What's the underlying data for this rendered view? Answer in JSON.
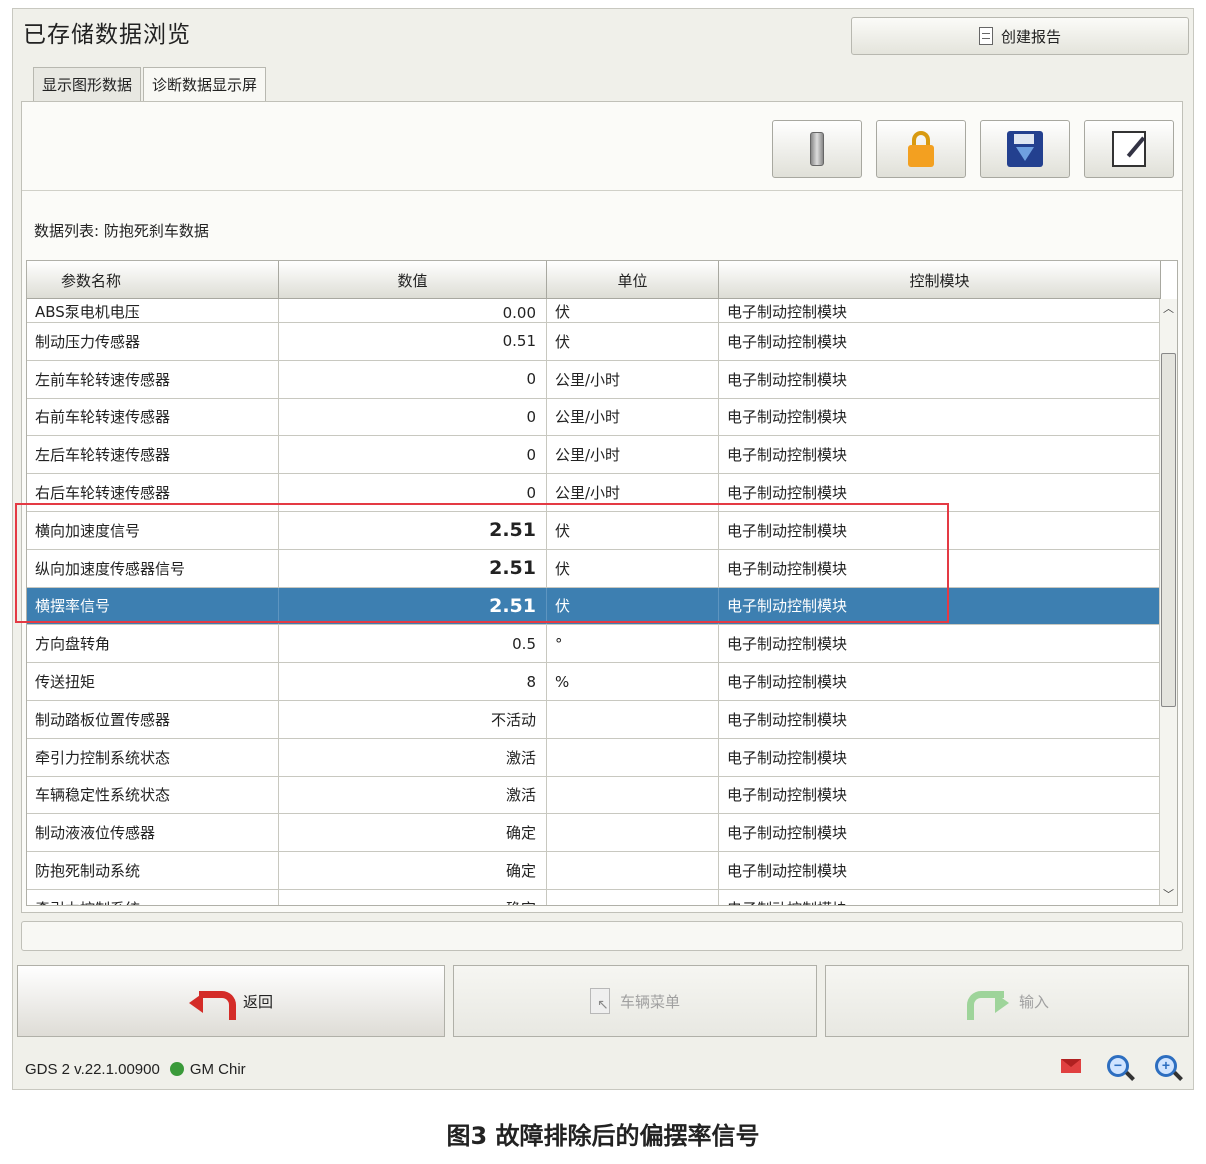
{
  "window": {
    "title": "已存储数据浏览",
    "create_report_label": "创建报告"
  },
  "tabs": [
    {
      "label": "显示图形数据",
      "active": false
    },
    {
      "label": "诊断数据显示屏",
      "active": true
    }
  ],
  "toolbar": {
    "icons": [
      "tool-icon",
      "lock-icon",
      "save-icon",
      "edit-icon"
    ]
  },
  "data_list": {
    "label": "数据列表:  防抱死刹车数据",
    "columns": [
      "参数名称",
      "数值",
      "单位",
      "控制模块"
    ],
    "rows": [
      {
        "name": "ABS泵电机电压",
        "value": "0.00",
        "unit": "伏",
        "module": "电子制动控制模块"
      },
      {
        "name": "制动压力传感器",
        "value": "0.51",
        "unit": "伏",
        "module": "电子制动控制模块"
      },
      {
        "name": "左前车轮转速传感器",
        "value": "0",
        "unit": "公里/小时",
        "module": "电子制动控制模块"
      },
      {
        "name": "右前车轮转速传感器",
        "value": "0",
        "unit": "公里/小时",
        "module": "电子制动控制模块"
      },
      {
        "name": "左后车轮转速传感器",
        "value": "0",
        "unit": "公里/小时",
        "module": "电子制动控制模块"
      },
      {
        "name": "右后车轮转速传感器",
        "value": "0",
        "unit": "公里/小时",
        "module": "电子制动控制模块"
      },
      {
        "name": "横向加速度信号",
        "value": "2.51",
        "unit": "伏",
        "module": "电子制动控制模块"
      },
      {
        "name": "纵向加速度传感器信号",
        "value": "2.51",
        "unit": "伏",
        "module": "电子制动控制模块"
      },
      {
        "name": "横摆率信号",
        "value": "2.51",
        "unit": "伏",
        "module": "电子制动控制模块"
      },
      {
        "name": "方向盘转角",
        "value": "0.5",
        "unit": "°",
        "module": "电子制动控制模块"
      },
      {
        "name": "传送扭矩",
        "value": "8",
        "unit": "%",
        "module": "电子制动控制模块"
      },
      {
        "name": "制动踏板位置传感器",
        "value": "不活动",
        "unit": "",
        "module": "电子制动控制模块"
      },
      {
        "name": "牵引力控制系统状态",
        "value": "激活",
        "unit": "",
        "module": "电子制动控制模块"
      },
      {
        "name": "车辆稳定性系统状态",
        "value": "激活",
        "unit": "",
        "module": "电子制动控制模块"
      },
      {
        "name": "制动液液位传感器",
        "value": "确定",
        "unit": "",
        "module": "电子制动控制模块"
      },
      {
        "name": "防抱死制动系统",
        "value": "确定",
        "unit": "",
        "module": "电子制动控制模块"
      },
      {
        "name": "牵引力控制系统",
        "value": "确定",
        "unit": "",
        "module": "电子制动控制模块"
      }
    ]
  },
  "bottom_buttons": {
    "back_label": "返回",
    "vehicle_menu_label": "车辆菜单",
    "input_label": "输入"
  },
  "status_bar": {
    "version": "GDS 2 v.22.1.00900",
    "region": "GM Chir"
  },
  "caption": "图3 故障排除后的偏摆率信号",
  "colors": {
    "selected_row": "#3d7fb1",
    "highlight_box": "#e43a44",
    "status_dot": "#3a9a3a"
  }
}
